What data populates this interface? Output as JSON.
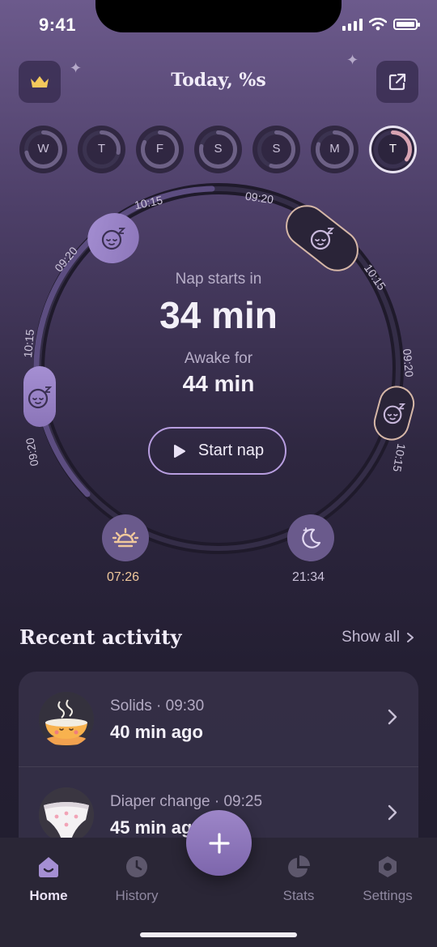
{
  "status": {
    "time": "9:41"
  },
  "header": {
    "title": "Today, %s",
    "premium_icon": "crown-icon",
    "share_icon": "share-icon"
  },
  "days": [
    {
      "label": "W",
      "progress": 0.72
    },
    {
      "label": "T",
      "progress": 0.28
    },
    {
      "label": "F",
      "progress": 0.82
    },
    {
      "label": "S",
      "progress": 0.78
    },
    {
      "label": "S",
      "progress": 0.55
    },
    {
      "label": "M",
      "progress": 0.8
    },
    {
      "label": "T",
      "progress": 0.35,
      "active": true
    }
  ],
  "dial": {
    "naps": [
      {
        "start": "09:20",
        "end": "10:15",
        "state": "completed"
      },
      {
        "start": "09:20",
        "end": "10:15",
        "state": "completed"
      },
      {
        "start": "09:20",
        "end": "10:15",
        "state": "planned"
      },
      {
        "start": "09:20",
        "end": "10:15",
        "state": "planned"
      }
    ],
    "nap_starts_label": "Nap starts in",
    "nap_starts_value": "34 min",
    "awake_label": "Awake for",
    "awake_value": "44 min",
    "start_button": "Start nap",
    "wake_time": "07:26",
    "bed_time": "21:34"
  },
  "recent": {
    "title": "Recent activity",
    "show_all": "Show all",
    "items": [
      {
        "meta": "Solids · 09:30",
        "value": "40 min ago",
        "icon": "bowl-icon"
      },
      {
        "meta": "Diaper change · 09:25",
        "value": "45 min ago",
        "icon": "diaper-icon"
      }
    ]
  },
  "tabs": [
    {
      "label": "Home",
      "icon": "home-icon",
      "active": true
    },
    {
      "label": "History",
      "icon": "clock-icon"
    },
    {
      "label": "Stats",
      "icon": "pie-chart-icon"
    },
    {
      "label": "Settings",
      "icon": "gear-icon"
    }
  ],
  "colors": {
    "accent": "#a58fd3",
    "background": "#2a2538",
    "wake": "#f0c89c"
  }
}
